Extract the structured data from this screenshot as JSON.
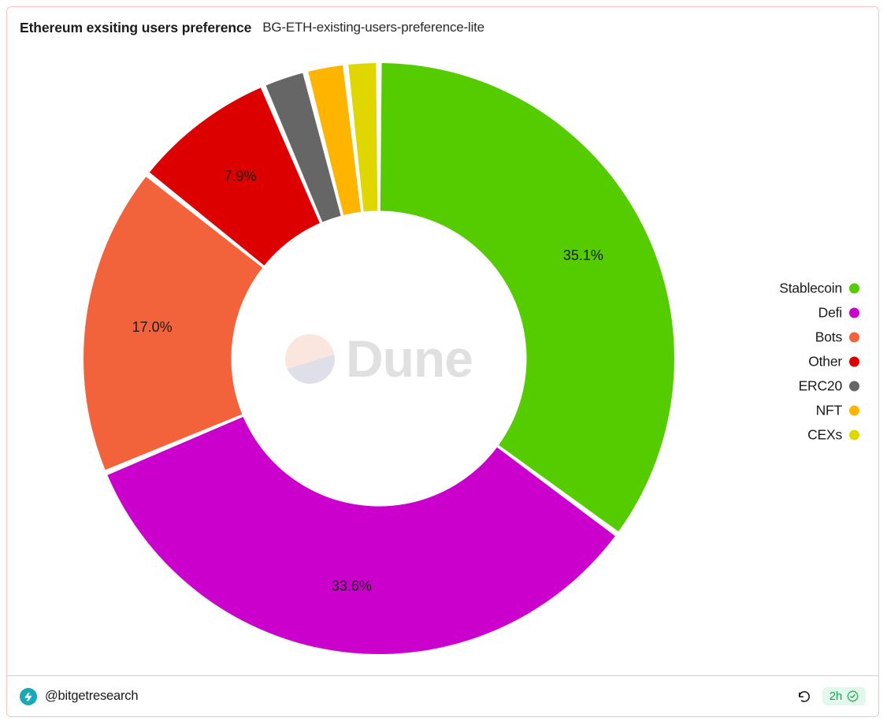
{
  "header": {
    "title": "Ethereum exsiting users preference",
    "subtitle": "BG-ETH-existing-users-preference-lite"
  },
  "footer": {
    "handle": "@bitgetresearch",
    "avatar_icon": "bitget-logo-icon",
    "refresh_icon": "refresh-counterclockwise-icon",
    "freshness_label": "2h",
    "freshness_icon": "verified-check-badge-icon",
    "freshness_color": "#16a34a",
    "freshness_bg": "#e4f7ec"
  },
  "watermark": {
    "text": "Dune",
    "logo_icon": "dune-circle-logo-icon",
    "color": "#dddddd"
  },
  "legend": {
    "position": "right",
    "items": [
      {
        "label": "Stablecoin",
        "color": "#55cc00"
      },
      {
        "label": "Defi",
        "color": "#cc00cc"
      },
      {
        "label": "Bots",
        "color": "#f2633c"
      },
      {
        "label": "Other",
        "color": "#dd0000"
      },
      {
        "label": "ERC20",
        "color": "#666666"
      },
      {
        "label": "NFT",
        "color": "#ffb400"
      },
      {
        "label": "CEXs",
        "color": "#e0d700"
      }
    ]
  },
  "chart_data": {
    "type": "pie",
    "variant": "donut",
    "title": "Ethereum exsiting users preference",
    "subtitle": "BG-ETH-existing-users-preference-lite",
    "labels": [
      "Stablecoin",
      "Defi",
      "Bots",
      "Other",
      "ERC20",
      "NFT",
      "CEXs"
    ],
    "values": [
      35.1,
      33.6,
      17.0,
      7.9,
      2.4,
      2.2,
      1.8
    ],
    "unit": "%",
    "colors": [
      "#55cc00",
      "#cc00cc",
      "#f2633c",
      "#dd0000",
      "#666666",
      "#ffb400",
      "#e0d700"
    ],
    "data_labels": [
      "35.1%",
      "33.6%",
      "17.0%",
      "7.9%",
      "",
      "",
      ""
    ],
    "data_label_color": "#1b1b1d",
    "start_angle_deg": 0,
    "direction": "clockwise",
    "inner_radius_ratio": 0.5,
    "slice_gap": true,
    "legend_position": "right",
    "grid": false
  }
}
